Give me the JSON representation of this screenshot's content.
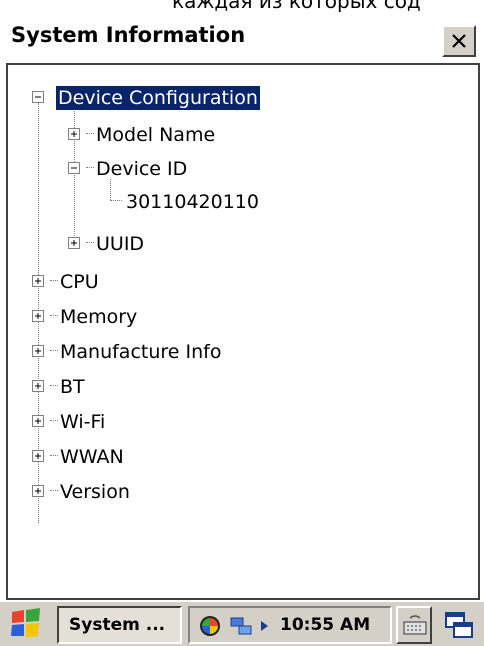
{
  "top_caption": "каждая из которых сод",
  "window": {
    "title": "System Information",
    "close_icon": "close-x-icon"
  },
  "tree": {
    "nodes": [
      {
        "label": "Device Configuration",
        "expanded": true,
        "selected": true,
        "level": 0
      },
      {
        "label": "Model Name",
        "expanded": false,
        "level": 1
      },
      {
        "label": "Device ID",
        "expanded": true,
        "level": 1
      },
      {
        "label": "30110420110",
        "leaf": true,
        "level": 2
      },
      {
        "label": "UUID",
        "expanded": false,
        "level": 1
      },
      {
        "label": "CPU",
        "expanded": false,
        "level": 0
      },
      {
        "label": "Memory",
        "expanded": false,
        "level": 0
      },
      {
        "label": "Manufacture Info",
        "expanded": false,
        "level": 0
      },
      {
        "label": "BT",
        "expanded": false,
        "level": 0
      },
      {
        "label": "Wi-Fi",
        "expanded": false,
        "level": 0
      },
      {
        "label": "WWAN",
        "expanded": false,
        "level": 0
      },
      {
        "label": "Version",
        "expanded": false,
        "level": 0
      }
    ]
  },
  "taskbar": {
    "start_icon": "windows-flag-icon",
    "task_label": "System ...",
    "tray_icons": [
      "color-wheel-icon",
      "network-icon",
      "arrow-right-icon"
    ],
    "clock": "10:55 AM",
    "keyboard_icon": "keyboard-icon",
    "desktop_icon": "desktop-windows-icon"
  },
  "colors": {
    "selection": "#0a246a",
    "chrome": "#d4d0c8"
  }
}
